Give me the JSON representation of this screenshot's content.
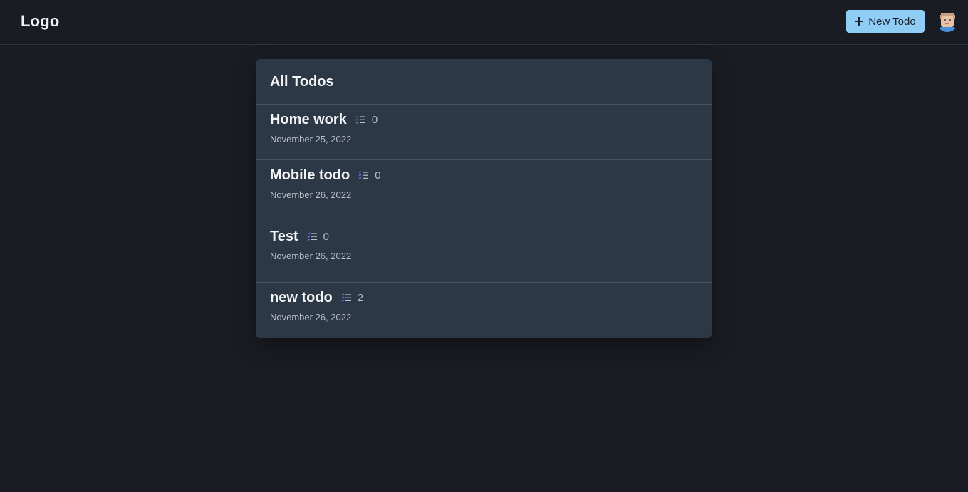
{
  "header": {
    "logo": "Logo",
    "new_todo_label": "New Todo",
    "accent_color": "#90cdf4"
  },
  "todos": {
    "title": "All Todos",
    "items": [
      {
        "name": "Home work",
        "count": "0",
        "date": "November 25, 2022"
      },
      {
        "name": "Mobile todo",
        "count": "0",
        "date": "November 26, 2022"
      },
      {
        "name": "Test",
        "count": "0",
        "date": "November 26, 2022"
      },
      {
        "name": "new todo",
        "count": "2",
        "date": "November 26, 2022"
      }
    ]
  },
  "icons": {
    "add": "plus-icon",
    "checklist": "checklist-icon",
    "user": "avatar"
  }
}
